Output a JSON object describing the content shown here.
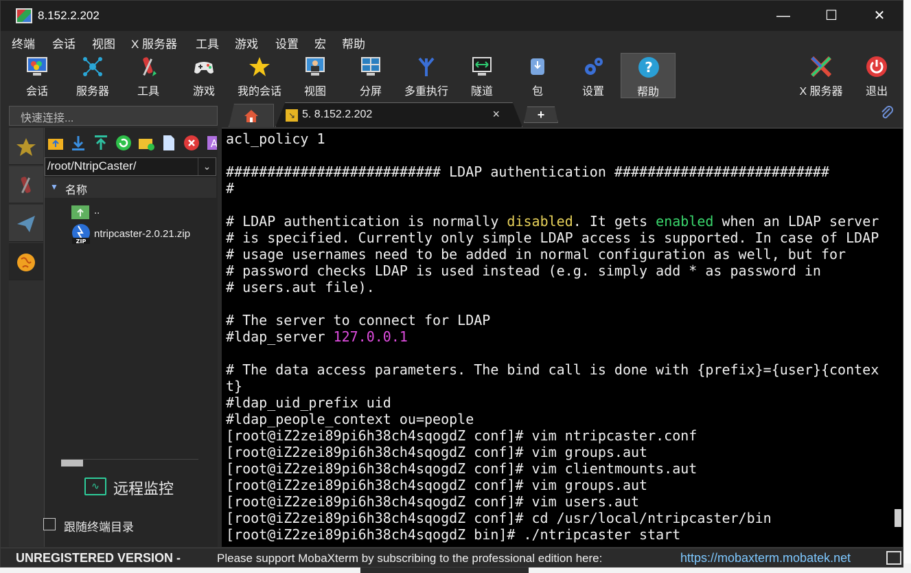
{
  "window": {
    "title": "8.152.2.202",
    "minimize": "—",
    "maximize": "☐",
    "close": "✕"
  },
  "menu": [
    "终端",
    "会话",
    "视图",
    "X 服务器",
    "工具",
    "游戏",
    "设置",
    "宏",
    "帮助"
  ],
  "toolbar": {
    "items": [
      {
        "label": "会话",
        "icon": "session-icon"
      },
      {
        "label": "服务器",
        "icon": "servers-icon"
      },
      {
        "label": "工具",
        "icon": "tools-icon"
      },
      {
        "label": "游戏",
        "icon": "gamepad-icon"
      },
      {
        "label": "我的会话",
        "icon": "star-icon"
      },
      {
        "label": "视图",
        "icon": "view-icon"
      },
      {
        "label": "分屏",
        "icon": "split-icon"
      },
      {
        "label": "多重执行",
        "icon": "multiexec-icon"
      },
      {
        "label": "隧道",
        "icon": "tunnel-icon"
      },
      {
        "label": "包",
        "icon": "package-icon"
      },
      {
        "label": "设置",
        "icon": "settings-icon"
      },
      {
        "label": "帮助",
        "icon": "help-icon"
      }
    ],
    "xserver": "X 服务器",
    "exit": "退出"
  },
  "quick_connect": {
    "placeholder": "快速连接..."
  },
  "sftp": {
    "path": "/root/NtripCaster/",
    "column": "名称",
    "files": [
      {
        "name": "..",
        "icon": "folder-up-icon"
      },
      {
        "name": "ntripcaster-2.0.21.zip",
        "icon": "zip-icon"
      }
    ],
    "remote_monitor": "远程监控",
    "follow_terminal": "跟随终端目录"
  },
  "tabs": {
    "session_title": "5. 8.152.2.202",
    "close": "×",
    "new": "+"
  },
  "terminal": {
    "lines": [
      [
        {
          "t": "acl_policy 1"
        }
      ],
      [
        {
          "t": ""
        }
      ],
      [
        {
          "t": "########################## LDAP authentication ##########################"
        }
      ],
      [
        {
          "t": "#"
        }
      ],
      [
        {
          "t": ""
        }
      ],
      [
        {
          "t": "# LDAP authentication is normally "
        },
        {
          "t": "disabled",
          "c": "c-yellow"
        },
        {
          "t": ". It gets "
        },
        {
          "t": "enabled",
          "c": "c-green"
        },
        {
          "t": " when an LDAP server"
        }
      ],
      [
        {
          "t": "# is specified. Currently only simple LDAP access is supported. In case of LDAP"
        }
      ],
      [
        {
          "t": "# usage usernames need to be added in normal configuration as well, but for"
        }
      ],
      [
        {
          "t": "# password checks LDAP is used instead (e.g. simply add * as password in"
        }
      ],
      [
        {
          "t": "# users.aut file)."
        }
      ],
      [
        {
          "t": ""
        }
      ],
      [
        {
          "t": "# The server to connect for LDAP"
        }
      ],
      [
        {
          "t": "#ldap_server "
        },
        {
          "t": "127.0.0.1",
          "c": "c-magenta"
        }
      ],
      [
        {
          "t": ""
        }
      ],
      [
        {
          "t": "# The data access parameters. The bind call is done with {prefix}={user}{contex"
        }
      ],
      [
        {
          "t": "t}"
        }
      ],
      [
        {
          "t": "#ldap_uid_prefix uid"
        }
      ],
      [
        {
          "t": "#ldap_people_context ou=people"
        }
      ],
      [
        {
          "t": "[root@iZ2zei89pi6h38ch4sqogdZ conf]# vim ntripcaster.conf"
        }
      ],
      [
        {
          "t": "[root@iZ2zei89pi6h38ch4sqogdZ conf]# vim groups.aut"
        }
      ],
      [
        {
          "t": "[root@iZ2zei89pi6h38ch4sqogdZ conf]# vim clientmounts.aut"
        }
      ],
      [
        {
          "t": "[root@iZ2zei89pi6h38ch4sqogdZ conf]# vim groups.aut"
        }
      ],
      [
        {
          "t": "[root@iZ2zei89pi6h38ch4sqogdZ conf]# vim users.aut"
        }
      ],
      [
        {
          "t": "[root@iZ2zei89pi6h38ch4sqogdZ conf]# cd /usr/local/ntripcaster/bin"
        }
      ],
      [
        {
          "t": "[root@iZ2zei89pi6h38ch4sqogdZ bin]# ./ntripcaster start"
        }
      ]
    ]
  },
  "status": {
    "unregistered": "UNREGISTERED VERSION  -",
    "message": "Please support MobaXterm by subscribing to the professional edition here:",
    "link": "https://mobaxterm.mobatek.net"
  },
  "colors": {
    "accent_yellow": "#e8d25a",
    "accent_green": "#3ad66c",
    "accent_magenta": "#e04de0",
    "link": "#7ec8ff"
  }
}
